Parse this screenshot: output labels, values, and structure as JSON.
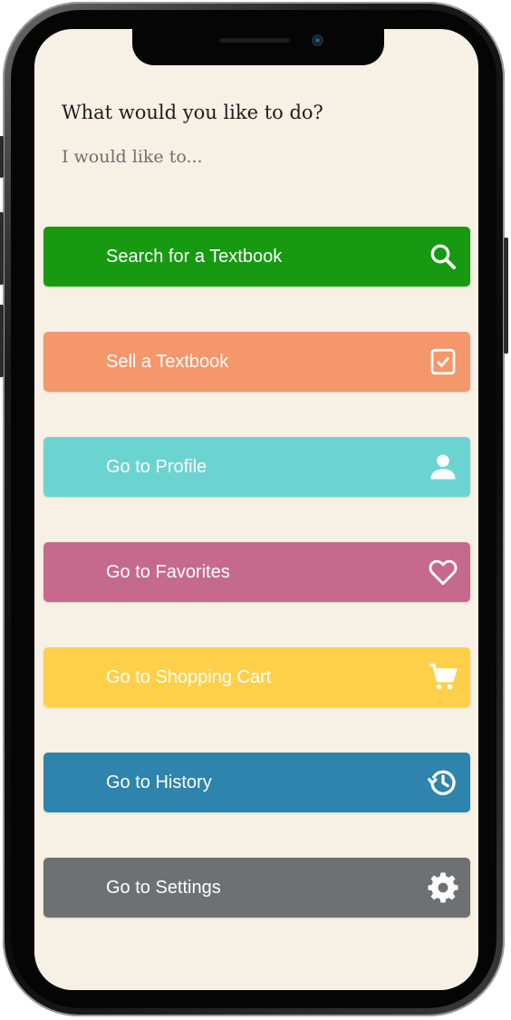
{
  "prompt": {
    "title": "What would you like to do?",
    "subtitle": "I would like to..."
  },
  "actions": [
    {
      "label": "Search for a Textbook",
      "icon": "search-icon",
      "color": "#179a12"
    },
    {
      "label": "Sell a Textbook",
      "icon": "checkbox-icon",
      "color": "#f4976a"
    },
    {
      "label": "Go to Profile",
      "icon": "person-icon",
      "color": "#6cd4d0"
    },
    {
      "label": "Go to Favorites",
      "icon": "heart-icon",
      "color": "#c66a8b"
    },
    {
      "label": "Go to Shopping Cart",
      "icon": "cart-icon",
      "color": "#fed049"
    },
    {
      "label": "Go to History",
      "icon": "history-icon",
      "color": "#2e84ac"
    },
    {
      "label": "Go to Settings",
      "icon": "gear-icon",
      "color": "#6d7173"
    }
  ],
  "theme": {
    "background": "#f7f0e4",
    "text": "#1d1d1d",
    "muted_text": "#707070"
  }
}
